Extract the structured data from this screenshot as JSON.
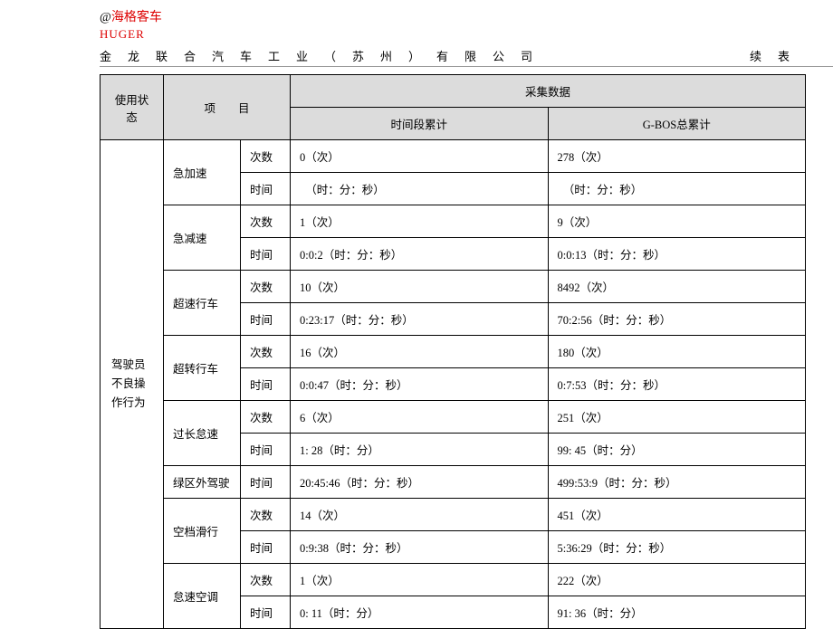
{
  "header": {
    "at": "@",
    "brand_cn": "海格客车",
    "brand_en": "HUGER",
    "company": "金龙联合汽车工业（苏州）有限公司",
    "cont": "续表"
  },
  "thead": {
    "col_status": "使用状态",
    "col_item": "项　　目",
    "col_data": "采集数据",
    "col_period": "时间段累计",
    "col_gbos": "G-BOS总累计"
  },
  "labels": {
    "count": "次数",
    "time": "时间"
  },
  "category": "驾驶员不良操作行为",
  "items": {
    "r0": {
      "name": "急加速",
      "count_p": "0（次）",
      "count_g": "278（次）",
      "time_p": "　（时：分：秒）",
      "time_g": "　（时：分：秒）"
    },
    "r1": {
      "name": "急减速",
      "count_p": "1（次）",
      "count_g": "9（次）",
      "time_p": "0:0:2（时：分：秒）",
      "time_g": "0:0:13（时：分：秒）"
    },
    "r2": {
      "name": "超速行车",
      "count_p": "10（次）",
      "count_g": "8492（次）",
      "time_p": "0:23:17（时：分：秒）",
      "time_g": "70:2:56（时：分：秒）"
    },
    "r3": {
      "name": "超转行车",
      "count_p": "16（次）",
      "count_g": "180（次）",
      "time_p": "0:0:47（时：分：秒）",
      "time_g": "0:7:53（时：分：秒）"
    },
    "r4": {
      "name": "过长怠速",
      "count_p": "6（次）",
      "count_g": "251（次）",
      "time_p": "1: 28（时：分）",
      "time_g": "99: 45（时：分）"
    },
    "r5": {
      "name": "绿区外驾驶",
      "time_p": "20:45:46（时：分：秒）",
      "time_g": "499:53:9（时：分：秒）"
    },
    "r6": {
      "name": "空档滑行",
      "count_p": "14（次）",
      "count_g": "451（次）",
      "time_p": "0:9:38（时：分：秒）",
      "time_g": "5:36:29（时：分：秒）"
    },
    "r7": {
      "name": "怠速空调",
      "count_p": "1（次）",
      "count_g": "222（次）",
      "time_p": "0: 11（时：分）",
      "time_g": "91: 36（时：分）"
    }
  }
}
